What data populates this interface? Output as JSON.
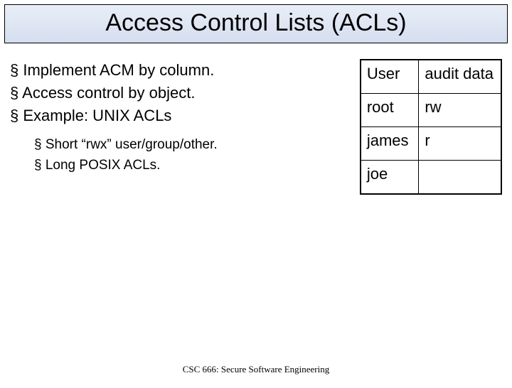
{
  "title": "Access Control Lists (ACLs)",
  "bullets": {
    "main": [
      "Implement ACM by column.",
      "Access control by object.",
      "Example: UNIX ACLs"
    ],
    "sub": [
      "Short “rwx” user/group/other.",
      "Long POSIX ACLs."
    ]
  },
  "table": {
    "rows": [
      {
        "c0": "User",
        "c1": "audit data"
      },
      {
        "c0": "root",
        "c1": "rw"
      },
      {
        "c0": "james",
        "c1": "r"
      },
      {
        "c0": "joe",
        "c1": ""
      }
    ]
  },
  "footer": "CSC 666: Secure Software Engineering"
}
